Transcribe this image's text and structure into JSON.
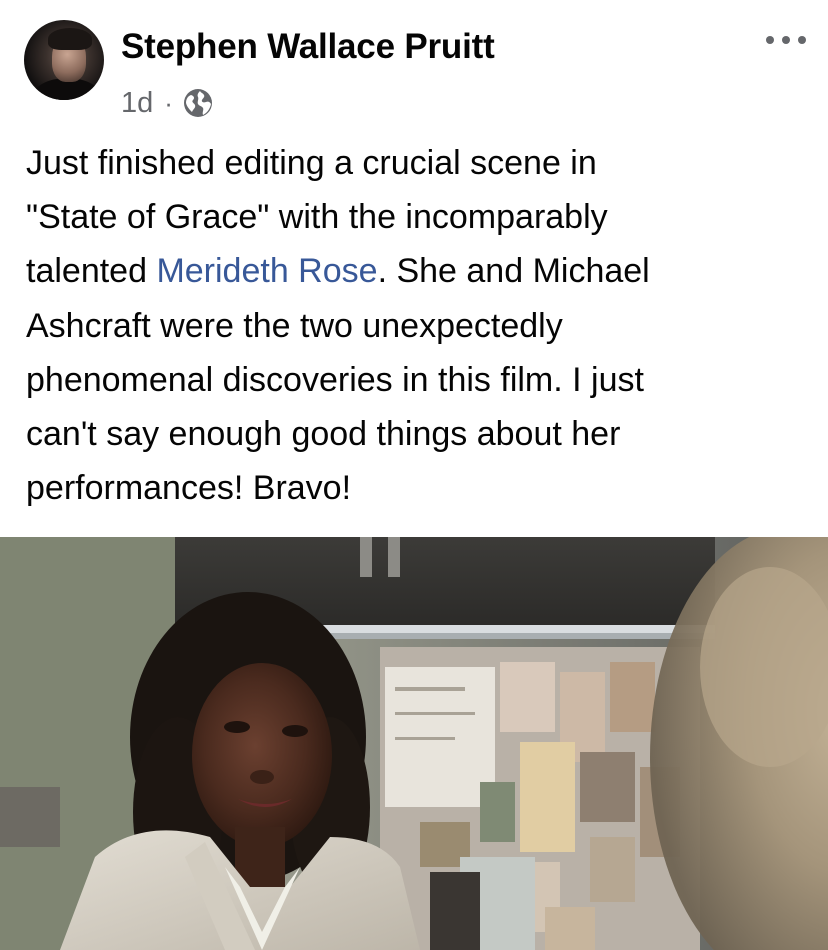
{
  "post": {
    "author": {
      "name": "Stephen Wallace Pruitt",
      "avatar_icon": "profile-photo"
    },
    "meta": {
      "time": "1d",
      "separator": "·",
      "audience_icon": "globe-icon"
    },
    "more_icon": "more-options-icon",
    "text": {
      "line1": "Just finished editing a crucial scene in",
      "line2": "\"State of Grace\" with the incomparably",
      "line3_before": "talented ",
      "mention": "Merideth Rose",
      "line3_after": ".  She and Michael",
      "line4": "Ashcraft were the two unexpectedly",
      "line5": "phenomenal discoveries in this film.  I just",
      "line6": "can't say enough good things about her",
      "line7": "performances!  Bravo!"
    },
    "photo": {
      "description_icon": "film-still-image"
    }
  },
  "colors": {
    "text_primary": "#050505",
    "text_secondary": "#65676b",
    "link": "#385898",
    "background": "#ffffff"
  }
}
